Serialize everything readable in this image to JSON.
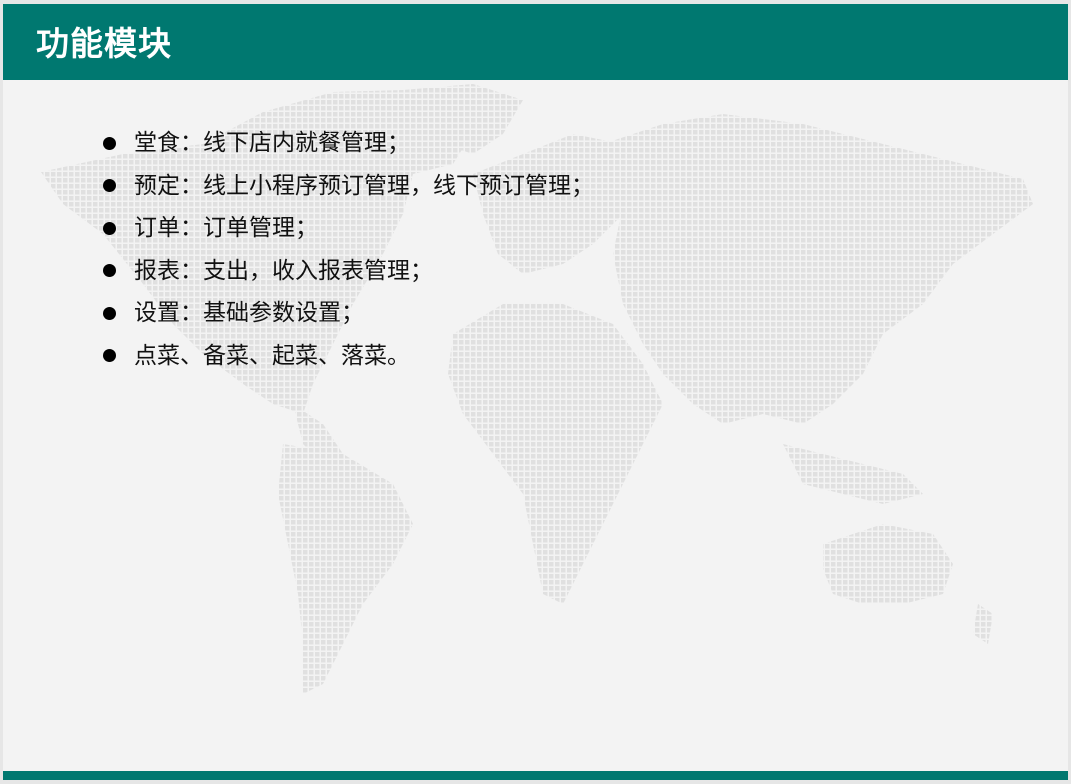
{
  "slide": {
    "title": "功能模块",
    "items": [
      {
        "text": "堂食：线下店内就餐管理；"
      },
      {
        "text": "预定：线上小程序预订管理，线下预订管理；"
      },
      {
        "text": "订单：订单管理；"
      },
      {
        "text": "报表：支出，收入报表管理；"
      },
      {
        "text": "设置：基础参数设置；"
      },
      {
        "text": "点菜、备菜、起菜、落菜。"
      }
    ]
  },
  "colors": {
    "header": "#007870",
    "footer": "#007870",
    "background": "#f3f3f3",
    "map_dots": "#e2e2e2",
    "text": "#111111"
  },
  "icons": {
    "bullet": "bullet-dot-icon",
    "background": "world-map-dotted"
  }
}
